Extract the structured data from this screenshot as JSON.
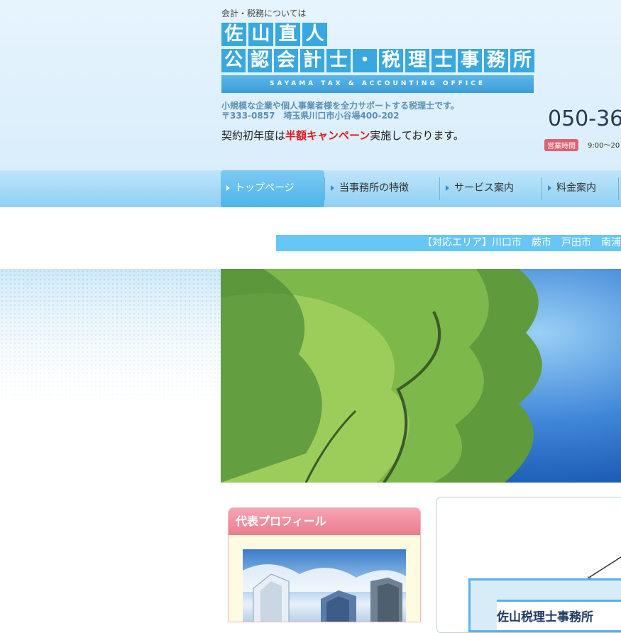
{
  "header": {
    "tagline_small": "会計・税務については",
    "logo_line1": [
      "佐",
      "山",
      "直",
      "人"
    ],
    "logo_line2": [
      "公",
      "認",
      "会",
      "計",
      "士",
      "・",
      "税",
      "理",
      "士",
      "事",
      "務",
      "所"
    ],
    "logo_english": "SAYAMA TAX & ACCOUNTING OFFICE",
    "description": "小規模な企業や個人事業者様を全力サポートする税理士です。",
    "address": "〒333-0857　埼玉県川口市小谷場400-202",
    "campaign_prefix": "契約初年度は",
    "campaign_highlight": "半額キャンペーン",
    "campaign_suffix": "実施しております。",
    "phone": "050-36",
    "hours_badge": "営業時間",
    "hours_text": "9:00〜20"
  },
  "nav": {
    "items": [
      {
        "label": "トップページ",
        "active": true
      },
      {
        "label": "当事務所の特徴"
      },
      {
        "label": "サービス案内"
      },
      {
        "label": "料金案内"
      }
    ]
  },
  "area_bar": "【対応エリア】川口市　蕨市　戸田市　南浦",
  "profile": {
    "title": "代表プロフィール"
  },
  "sign": {
    "text": "佐山税理士事務所"
  },
  "colors": {
    "accent": "#3aa8e0",
    "campaign_red": "#e0181b",
    "profile_pink": "#ea7c8f",
    "area_bar": "#66c6f5"
  }
}
